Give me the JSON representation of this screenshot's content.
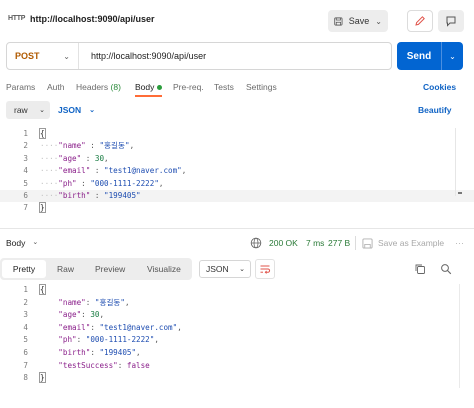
{
  "tab": {
    "protocol": "HTTP",
    "title": "http://localhost:9090/api/user"
  },
  "toolbar": {
    "save_label": "Save"
  },
  "request": {
    "method": "POST",
    "url": "http://localhost:9090/api/user",
    "send_label": "Send"
  },
  "request_tabs": {
    "params": "Params",
    "auth": "Auth",
    "headers": "Headers",
    "headers_count": "(8)",
    "body": "Body",
    "prereq": "Pre-req.",
    "tests": "Tests",
    "settings": "Settings",
    "cookies": "Cookies"
  },
  "body_options": {
    "mode": "raw",
    "language": "JSON",
    "beautify": "Beautify"
  },
  "request_body": {
    "line_numbers": [
      "1",
      "2",
      "3",
      "4",
      "5",
      "6",
      "7"
    ],
    "open_brace": "{",
    "close_brace": "}",
    "fields": [
      {
        "key": "\"name\"",
        "value": "\"홍길동\""
      },
      {
        "key": "\"age\"",
        "value": "30"
      },
      {
        "key": "\"email\"",
        "value": "\"test1@naver.com\""
      },
      {
        "key": "\"ph\"",
        "value": "\"000-1111-2222\""
      },
      {
        "key": "\"birth\"",
        "value": "\"199405\""
      }
    ]
  },
  "response": {
    "body_label": "Body",
    "status": "200 OK",
    "time": "7 ms",
    "size": "277 B",
    "save_example": "Save as Example",
    "tabs": {
      "pretty": "Pretty",
      "raw": "Raw",
      "preview": "Preview",
      "visualize": "Visualize"
    },
    "format": "JSON",
    "line_numbers": [
      "1",
      "2",
      "3",
      "4",
      "5",
      "6",
      "7",
      "8"
    ],
    "open_brace": "{",
    "close_brace": "}",
    "fields": [
      {
        "key": "\"name\"",
        "value": "\"홍길동\""
      },
      {
        "key": "\"age\"",
        "value": "30"
      },
      {
        "key": "\"email\"",
        "value": "\"test1@naver.com\""
      },
      {
        "key": "\"ph\"",
        "value": "\"000-1111-2222\""
      },
      {
        "key": "\"birth\"",
        "value": "\"199405\""
      },
      {
        "key": "\"testSuccess\"",
        "value": "false"
      }
    ]
  },
  "colors": {
    "send": "#0265d2",
    "active_tab": "#ff6c37",
    "method": "#b05a00",
    "link": "#1164c5",
    "status": "#2a7a37"
  },
  "icons": [
    "http-icon",
    "save-icon",
    "edit-icon",
    "comment-icon",
    "globe-icon",
    "copy-icon",
    "search-icon",
    "wrap-icon",
    "more-icon"
  ]
}
